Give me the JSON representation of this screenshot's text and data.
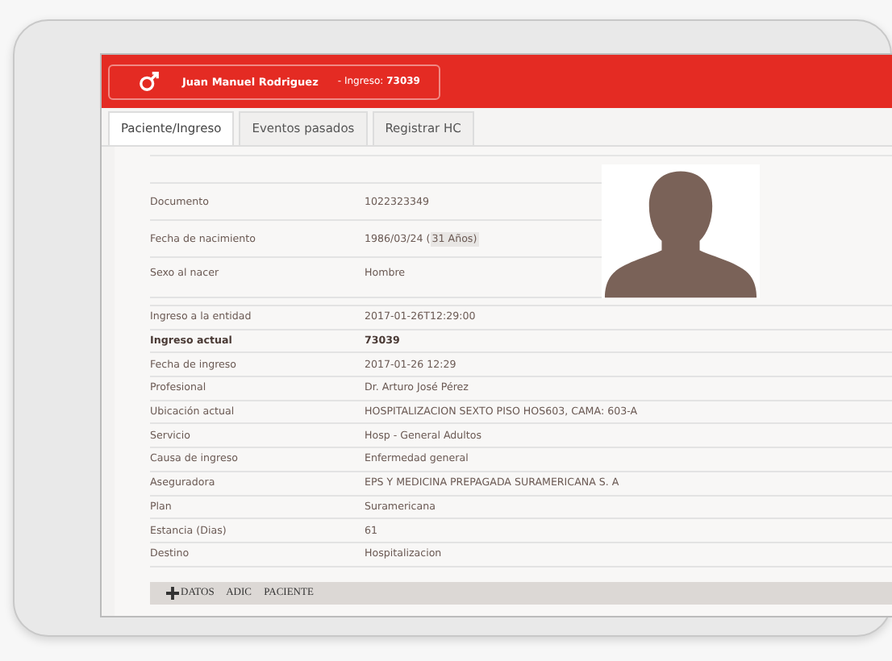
{
  "header": {
    "patient_name": "Juan Manuel Rodriguez",
    "admission": "- Ingreso: **73039**"
  },
  "tabs": [
    {
      "label": "Paciente/Ingreso",
      "selected": true
    },
    {
      "label": "Eventos pasados",
      "selected": false
    },
    {
      "label": "Registrar HC",
      "selected": false
    }
  ],
  "patient": [
    {
      "label": "Documento",
      "value": "1022323349"
    },
    {
      "label": "Fecha de nacimiento",
      "value": "1986/03/24 (",
      "tag": "31 Años)"
    },
    {
      "label": "Sexo al nacer",
      "value": "Hombre"
    }
  ],
  "admission": [
    {
      "label": "Ingreso a la entidad",
      "value": "2017-01-26T12:29:00",
      "bold": false
    },
    {
      "label": "Ingreso actual",
      "value": "73039",
      "bold": true
    },
    {
      "label": "Fecha de ingreso",
      "value": "2017-01-26 12:29",
      "bold": false
    },
    {
      "label": "Profesional",
      "value": "Dr. Arturo José Pérez",
      "bold": false
    },
    {
      "label": "Ubicación actual",
      "value": "HOSPITALIZACION SEXTO PISO HOS603, CAMA: 603-A",
      "bold": false
    },
    {
      "label": "Servicio",
      "value": "Hosp - General Adultos",
      "bold": false
    },
    {
      "label": "Causa de ingreso",
      "value": "Enfermedad general",
      "bold": false
    },
    {
      "label": "Aseguradora",
      "value": "EPS Y MEDICINA PREPAGADA SURAMERICANA S. A",
      "bold": false
    },
    {
      "label": "Plan",
      "value": "Suramericana",
      "bold": false
    },
    {
      "label": "Estancia (Dias)",
      "value": "61",
      "bold": false
    },
    {
      "label": "Destino",
      "value": "Hospitalizacion",
      "bold": false
    }
  ],
  "footer_bar": {
    "label": "DATOS ADIC PACIENTE"
  }
}
